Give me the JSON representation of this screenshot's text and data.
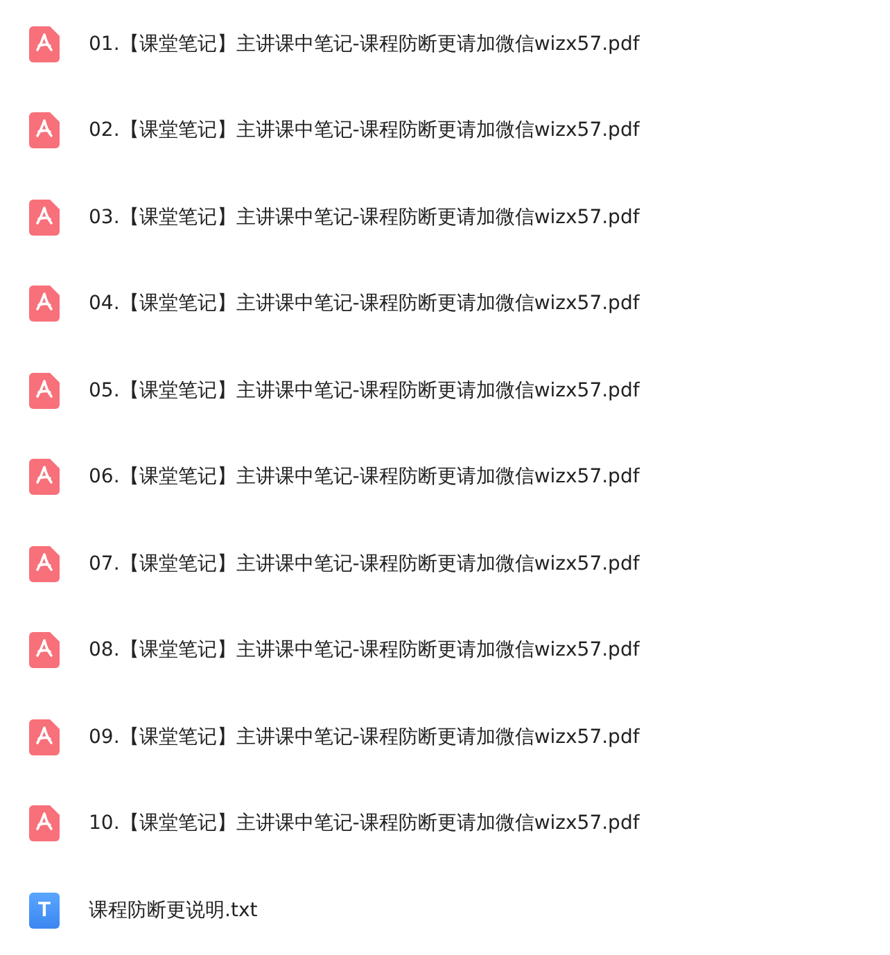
{
  "files": [
    {
      "kind": "pdf",
      "name": "01.【课堂笔记】主讲课中笔记-课程防断更请加微信wizx57.pdf"
    },
    {
      "kind": "pdf",
      "name": "02.【课堂笔记】主讲课中笔记-课程防断更请加微信wizx57.pdf"
    },
    {
      "kind": "pdf",
      "name": "03.【课堂笔记】主讲课中笔记-课程防断更请加微信wizx57.pdf"
    },
    {
      "kind": "pdf",
      "name": "04.【课堂笔记】主讲课中笔记-课程防断更请加微信wizx57.pdf"
    },
    {
      "kind": "pdf",
      "name": "05.【课堂笔记】主讲课中笔记-课程防断更请加微信wizx57.pdf"
    },
    {
      "kind": "pdf",
      "name": "06.【课堂笔记】主讲课中笔记-课程防断更请加微信wizx57.pdf"
    },
    {
      "kind": "pdf",
      "name": "07.【课堂笔记】主讲课中笔记-课程防断更请加微信wizx57.pdf"
    },
    {
      "kind": "pdf",
      "name": "08.【课堂笔记】主讲课中笔记-课程防断更请加微信wizx57.pdf"
    },
    {
      "kind": "pdf",
      "name": "09.【课堂笔记】主讲课中笔记-课程防断更请加微信wizx57.pdf"
    },
    {
      "kind": "pdf",
      "name": "10.【课堂笔记】主讲课中笔记-课程防断更请加微信wizx57.pdf"
    },
    {
      "kind": "txt",
      "name": "课程防断更说明.txt",
      "icon_label": "T"
    }
  ]
}
